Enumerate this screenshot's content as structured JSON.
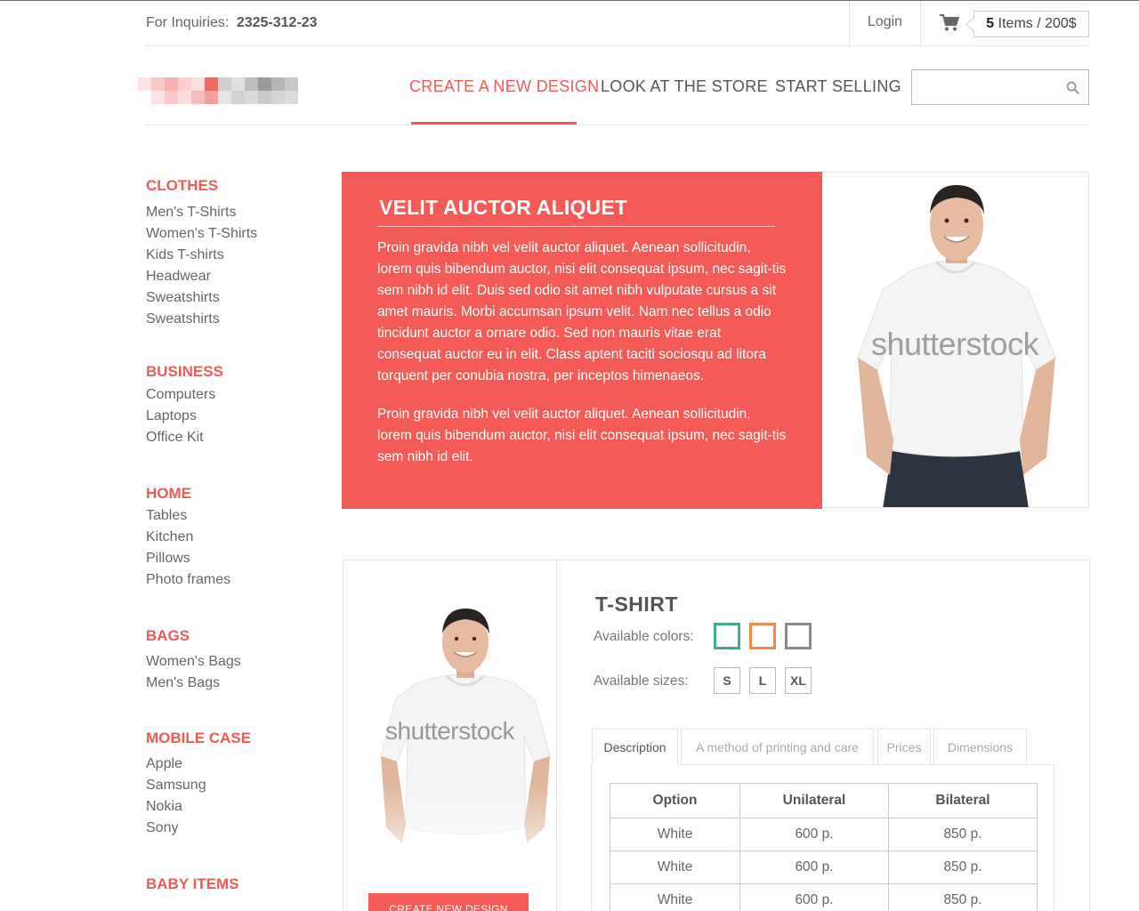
{
  "topbar": {
    "inquiry_label": "For Inquiries:",
    "inquiry_phone": "2325-312-23",
    "login": "Login",
    "cart_count": "5",
    "cart_text": " Items / 200$"
  },
  "nav": {
    "items": [
      {
        "label": "CREATE A NEW DESIGN",
        "active": true
      },
      {
        "label": "LOOK AT THE STORE",
        "active": false
      },
      {
        "label": "START SELLING",
        "active": false
      }
    ],
    "search_placeholder": ""
  },
  "sidebar": {
    "categories": [
      {
        "title": "CLOTHES",
        "items": [
          "Men's T-Shirts",
          "Women's T-Shirts",
          "Kids T-shirts",
          "Headwear",
          "Sweatshirts",
          "Sweatshirts"
        ]
      },
      {
        "title": "BUSINESS",
        "items": [
          "Computers",
          "Laptops",
          "Office Kit"
        ]
      },
      {
        "title": "HOME",
        "items": [
          "Tables",
          "Kitchen",
          "Pillows",
          "Photo frames"
        ]
      },
      {
        "title": "BAGS",
        "items": [
          "Women's Bags",
          "Men's Bags"
        ]
      },
      {
        "title": "MOBILE CASE",
        "items": [
          "Apple",
          "Samsung",
          "Nokia",
          "Sony"
        ]
      },
      {
        "title": "BABY ITEMS",
        "items": []
      }
    ]
  },
  "hero": {
    "title": "VELIT AUCTOR ALIQUET",
    "paragraph1": "Proin gravida nibh vel velit auctor aliquet. Aenean sollicitudin, lorem quis bibendum auctor, nisi elit consequat ipsum, nec sagit-tis sem nibh id elit. Duis sed odio sit amet nibh vulputate cursus a sit amet mauris. Morbi accumsan ipsum velit. Nam nec tellus a odio tincidunt auctor a ornare odio. Sed non  mauris vitae erat consequat auctor eu in elit. Class aptent taciti sociosqu ad litora torquent per conubia nostra, per inceptos himenaeos.",
    "paragraph2": "Proin gravida nibh vel velit auctor aliquet. Aenean sollicitudin, lorem quis bibendum auctor, nisi elit consequat ipsum, nec sagit-tis sem nibh id elit.",
    "watermark": "shutterstock"
  },
  "product": {
    "title": "T-SHIRT",
    "colors_label": "Available colors:",
    "colors": [
      "#3fae8c",
      "#f08a4b",
      "#8a8a8a"
    ],
    "sizes_label": "Available sizes:",
    "sizes": [
      "S",
      "L",
      "XL"
    ],
    "create_button": "CREATE NEW DESIGN",
    "watermark": "shutterstock",
    "tabs": [
      "Description",
      "A method of printing and care",
      "Prices",
      "Dimensions"
    ],
    "table": {
      "headers": [
        "Option",
        "Unilateral",
        "Bilateral"
      ],
      "rows": [
        [
          "White",
          "600 p.",
          "850 p."
        ],
        [
          "White",
          "600 p.",
          "850 p."
        ],
        [
          "White",
          "600 p.",
          "850 p."
        ]
      ]
    }
  }
}
